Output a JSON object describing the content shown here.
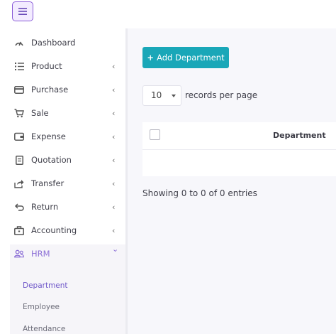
{
  "header": {
    "menu_toggle": "menu-icon"
  },
  "sidebar": {
    "items": [
      {
        "label": "Dashboard",
        "icon": "dashboard-icon",
        "has_chevron": false,
        "chevron": ""
      },
      {
        "label": "Product",
        "icon": "list-icon",
        "has_chevron": true,
        "chevron": "‹"
      },
      {
        "label": "Purchase",
        "icon": "credit-card-icon",
        "has_chevron": true,
        "chevron": "‹"
      },
      {
        "label": "Sale",
        "icon": "cart-icon",
        "has_chevron": true,
        "chevron": "‹"
      },
      {
        "label": "Expense",
        "icon": "wallet-icon",
        "has_chevron": true,
        "chevron": "‹"
      },
      {
        "label": "Quotation",
        "icon": "document-icon",
        "has_chevron": true,
        "chevron": "‹"
      },
      {
        "label": "Transfer",
        "icon": "share-icon",
        "has_chevron": true,
        "chevron": "‹"
      },
      {
        "label": "Return",
        "icon": "return-icon",
        "has_chevron": true,
        "chevron": "‹"
      },
      {
        "label": "Accounting",
        "icon": "briefcase-icon",
        "has_chevron": true,
        "chevron": "‹"
      },
      {
        "label": "HRM",
        "icon": "users-icon",
        "has_chevron": true,
        "chevron": "⌄",
        "expanded": true
      }
    ],
    "hrm_subitems": [
      {
        "label": "Department",
        "active": true
      },
      {
        "label": "Employee",
        "active": false
      },
      {
        "label": "Attendance",
        "active": false
      }
    ]
  },
  "main": {
    "add_button": {
      "icon": "+",
      "label": "Add Department"
    },
    "page_length": {
      "value": "10",
      "suffix": "records per page"
    },
    "table": {
      "columns": [
        "Department"
      ]
    },
    "info": "Showing 0 to 0 of 0 entries"
  },
  "colors": {
    "accent": "#8c6fd6",
    "button": "#19a7b8",
    "background": "#f7f7fb"
  }
}
